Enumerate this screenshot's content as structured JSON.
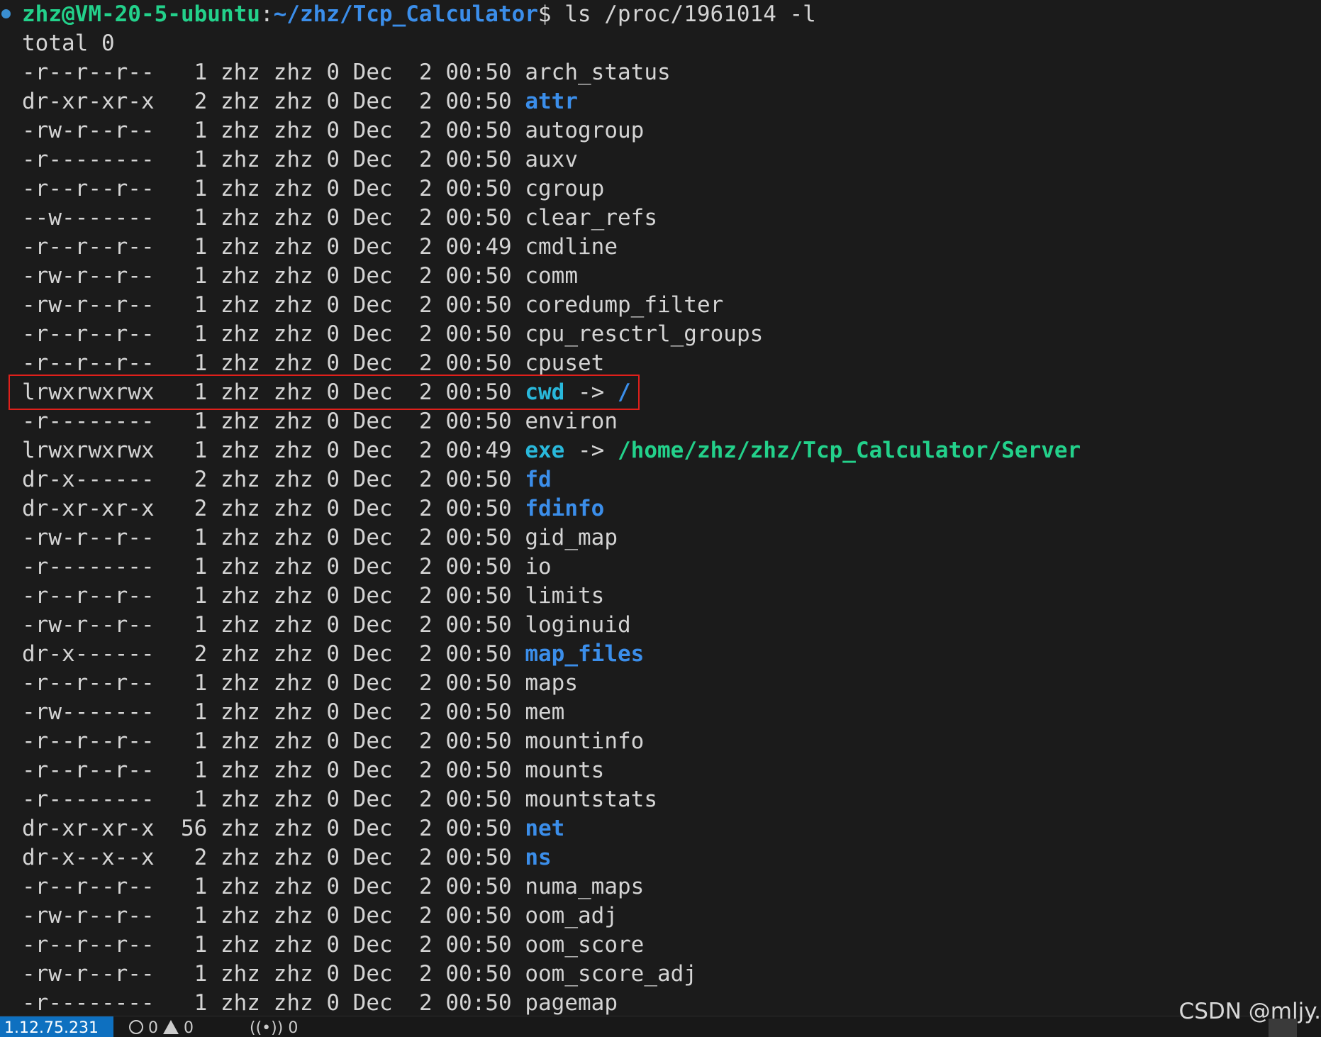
{
  "prompt": {
    "user_host": "zhz@VM-20-5-ubuntu",
    "sep": ":",
    "path": "~/zhz/Tcp_Calculator",
    "symbol": "$",
    "command": " ls /proc/1961014 -l"
  },
  "total_line": "total 0",
  "rows": [
    {
      "perm": "-r--r--r-- ",
      "links": " 1",
      "owner": "zhz",
      "group": "zhz",
      "size": "0",
      "month": "Dec",
      "day": " 2",
      "time": "00:50",
      "name": "arch_status",
      "type": "file",
      "target": ""
    },
    {
      "perm": "dr-xr-xr-x ",
      "links": " 2",
      "owner": "zhz",
      "group": "zhz",
      "size": "0",
      "month": "Dec",
      "day": " 2",
      "time": "00:50",
      "name": "attr",
      "type": "dir",
      "target": ""
    },
    {
      "perm": "-rw-r--r-- ",
      "links": " 1",
      "owner": "zhz",
      "group": "zhz",
      "size": "0",
      "month": "Dec",
      "day": " 2",
      "time": "00:50",
      "name": "autogroup",
      "type": "file",
      "target": ""
    },
    {
      "perm": "-r-------- ",
      "links": " 1",
      "owner": "zhz",
      "group": "zhz",
      "size": "0",
      "month": "Dec",
      "day": " 2",
      "time": "00:50",
      "name": "auxv",
      "type": "file",
      "target": ""
    },
    {
      "perm": "-r--r--r-- ",
      "links": " 1",
      "owner": "zhz",
      "group": "zhz",
      "size": "0",
      "month": "Dec",
      "day": " 2",
      "time": "00:50",
      "name": "cgroup",
      "type": "file",
      "target": ""
    },
    {
      "perm": "--w------- ",
      "links": " 1",
      "owner": "zhz",
      "group": "zhz",
      "size": "0",
      "month": "Dec",
      "day": " 2",
      "time": "00:50",
      "name": "clear_refs",
      "type": "file",
      "target": ""
    },
    {
      "perm": "-r--r--r-- ",
      "links": " 1",
      "owner": "zhz",
      "group": "zhz",
      "size": "0",
      "month": "Dec",
      "day": " 2",
      "time": "00:49",
      "name": "cmdline",
      "type": "file",
      "target": ""
    },
    {
      "perm": "-rw-r--r-- ",
      "links": " 1",
      "owner": "zhz",
      "group": "zhz",
      "size": "0",
      "month": "Dec",
      "day": " 2",
      "time": "00:50",
      "name": "comm",
      "type": "file",
      "target": ""
    },
    {
      "perm": "-rw-r--r-- ",
      "links": " 1",
      "owner": "zhz",
      "group": "zhz",
      "size": "0",
      "month": "Dec",
      "day": " 2",
      "time": "00:50",
      "name": "coredump_filter",
      "type": "file",
      "target": ""
    },
    {
      "perm": "-r--r--r-- ",
      "links": " 1",
      "owner": "zhz",
      "group": "zhz",
      "size": "0",
      "month": "Dec",
      "day": " 2",
      "time": "00:50",
      "name": "cpu_resctrl_groups",
      "type": "file",
      "target": ""
    },
    {
      "perm": "-r--r--r-- ",
      "links": " 1",
      "owner": "zhz",
      "group": "zhz",
      "size": "0",
      "month": "Dec",
      "day": " 2",
      "time": "00:50",
      "name": "cpuset",
      "type": "file",
      "target": ""
    },
    {
      "perm": "lrwxrwxrwx ",
      "links": " 1",
      "owner": "zhz",
      "group": "zhz",
      "size": "0",
      "month": "Dec",
      "day": " 2",
      "time": "00:50",
      "name": "cwd",
      "type": "link",
      "target": "/",
      "target_type": "dir"
    },
    {
      "perm": "-r-------- ",
      "links": " 1",
      "owner": "zhz",
      "group": "zhz",
      "size": "0",
      "month": "Dec",
      "day": " 2",
      "time": "00:50",
      "name": "environ",
      "type": "file",
      "target": ""
    },
    {
      "perm": "lrwxrwxrwx ",
      "links": " 1",
      "owner": "zhz",
      "group": "zhz",
      "size": "0",
      "month": "Dec",
      "day": " 2",
      "time": "00:49",
      "name": "exe",
      "type": "link",
      "target": "/home/zhz/zhz/Tcp_Calculator/Server",
      "target_type": "exe"
    },
    {
      "perm": "dr-x------ ",
      "links": " 2",
      "owner": "zhz",
      "group": "zhz",
      "size": "0",
      "month": "Dec",
      "day": " 2",
      "time": "00:50",
      "name": "fd",
      "type": "dir",
      "target": ""
    },
    {
      "perm": "dr-xr-xr-x ",
      "links": " 2",
      "owner": "zhz",
      "group": "zhz",
      "size": "0",
      "month": "Dec",
      "day": " 2",
      "time": "00:50",
      "name": "fdinfo",
      "type": "dir",
      "target": ""
    },
    {
      "perm": "-rw-r--r-- ",
      "links": " 1",
      "owner": "zhz",
      "group": "zhz",
      "size": "0",
      "month": "Dec",
      "day": " 2",
      "time": "00:50",
      "name": "gid_map",
      "type": "file",
      "target": ""
    },
    {
      "perm": "-r-------- ",
      "links": " 1",
      "owner": "zhz",
      "group": "zhz",
      "size": "0",
      "month": "Dec",
      "day": " 2",
      "time": "00:50",
      "name": "io",
      "type": "file",
      "target": ""
    },
    {
      "perm": "-r--r--r-- ",
      "links": " 1",
      "owner": "zhz",
      "group": "zhz",
      "size": "0",
      "month": "Dec",
      "day": " 2",
      "time": "00:50",
      "name": "limits",
      "type": "file",
      "target": ""
    },
    {
      "perm": "-rw-r--r-- ",
      "links": " 1",
      "owner": "zhz",
      "group": "zhz",
      "size": "0",
      "month": "Dec",
      "day": " 2",
      "time": "00:50",
      "name": "loginuid",
      "type": "file",
      "target": ""
    },
    {
      "perm": "dr-x------ ",
      "links": " 2",
      "owner": "zhz",
      "group": "zhz",
      "size": "0",
      "month": "Dec",
      "day": " 2",
      "time": "00:50",
      "name": "map_files",
      "type": "dir",
      "target": ""
    },
    {
      "perm": "-r--r--r-- ",
      "links": " 1",
      "owner": "zhz",
      "group": "zhz",
      "size": "0",
      "month": "Dec",
      "day": " 2",
      "time": "00:50",
      "name": "maps",
      "type": "file",
      "target": ""
    },
    {
      "perm": "-rw------- ",
      "links": " 1",
      "owner": "zhz",
      "group": "zhz",
      "size": "0",
      "month": "Dec",
      "day": " 2",
      "time": "00:50",
      "name": "mem",
      "type": "file",
      "target": ""
    },
    {
      "perm": "-r--r--r-- ",
      "links": " 1",
      "owner": "zhz",
      "group": "zhz",
      "size": "0",
      "month": "Dec",
      "day": " 2",
      "time": "00:50",
      "name": "mountinfo",
      "type": "file",
      "target": ""
    },
    {
      "perm": "-r--r--r-- ",
      "links": " 1",
      "owner": "zhz",
      "group": "zhz",
      "size": "0",
      "month": "Dec",
      "day": " 2",
      "time": "00:50",
      "name": "mounts",
      "type": "file",
      "target": ""
    },
    {
      "perm": "-r-------- ",
      "links": " 1",
      "owner": "zhz",
      "group": "zhz",
      "size": "0",
      "month": "Dec",
      "day": " 2",
      "time": "00:50",
      "name": "mountstats",
      "type": "file",
      "target": ""
    },
    {
      "perm": "dr-xr-xr-x ",
      "links": "56",
      "owner": "zhz",
      "group": "zhz",
      "size": "0",
      "month": "Dec",
      "day": " 2",
      "time": "00:50",
      "name": "net",
      "type": "dir",
      "target": ""
    },
    {
      "perm": "dr-x--x--x ",
      "links": " 2",
      "owner": "zhz",
      "group": "zhz",
      "size": "0",
      "month": "Dec",
      "day": " 2",
      "time": "00:50",
      "name": "ns",
      "type": "dir",
      "target": ""
    },
    {
      "perm": "-r--r--r-- ",
      "links": " 1",
      "owner": "zhz",
      "group": "zhz",
      "size": "0",
      "month": "Dec",
      "day": " 2",
      "time": "00:50",
      "name": "numa_maps",
      "type": "file",
      "target": ""
    },
    {
      "perm": "-rw-r--r-- ",
      "links": " 1",
      "owner": "zhz",
      "group": "zhz",
      "size": "0",
      "month": "Dec",
      "day": " 2",
      "time": "00:50",
      "name": "oom_adj",
      "type": "file",
      "target": ""
    },
    {
      "perm": "-r--r--r-- ",
      "links": " 1",
      "owner": "zhz",
      "group": "zhz",
      "size": "0",
      "month": "Dec",
      "day": " 2",
      "time": "00:50",
      "name": "oom_score",
      "type": "file",
      "target": ""
    },
    {
      "perm": "-rw-r--r-- ",
      "links": " 1",
      "owner": "zhz",
      "group": "zhz",
      "size": "0",
      "month": "Dec",
      "day": " 2",
      "time": "00:50",
      "name": "oom_score_adj",
      "type": "file",
      "target": ""
    },
    {
      "perm": "-r-------- ",
      "links": " 1",
      "owner": "zhz",
      "group": "zhz",
      "size": "0",
      "month": "Dec",
      "day": " 2",
      "time": "00:50",
      "name": "pagemap",
      "type": "file",
      "target": ""
    }
  ],
  "arrow": " -> ",
  "statusbar": {
    "remote": "1.12.75.231",
    "errors": "0",
    "warnings": "0",
    "ports": "0"
  },
  "watermark": "CSDN @mljy.",
  "colors": {
    "background": "#1b1b1b",
    "prompt_user": "#23d18b",
    "prompt_path": "#3b8eea",
    "dir": "#3b8eea",
    "link": "#29b8db",
    "exe_target": "#23d18b",
    "highlight_box": "#e0201b",
    "status_remote": "#0e70c0"
  },
  "icons": {
    "prompt_marker": "circle-dot-icon",
    "errors": "error-circle-icon",
    "warnings": "warning-triangle-icon",
    "ports": "broadcast-icon",
    "right": "add-icon"
  }
}
